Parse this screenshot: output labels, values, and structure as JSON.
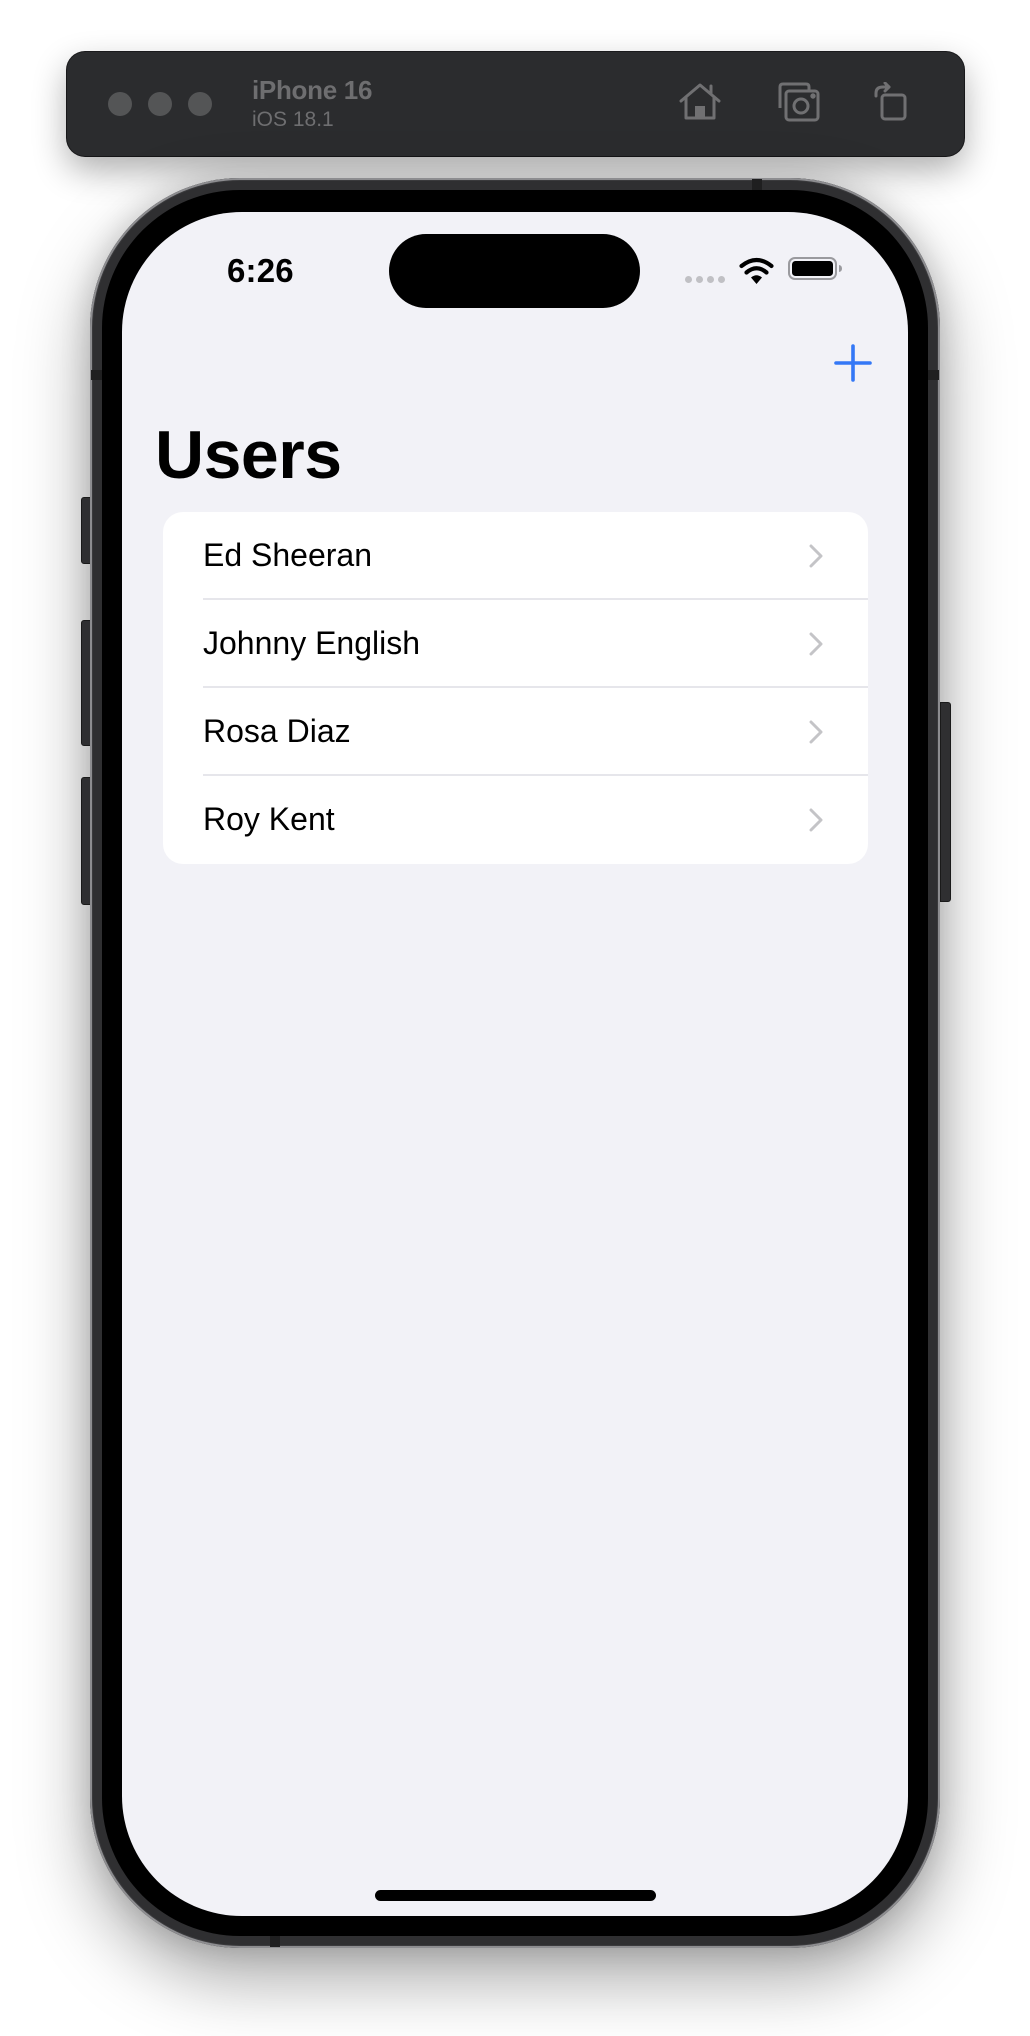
{
  "simulator": {
    "device_name": "iPhone 16",
    "os_version": "iOS 18.1",
    "toolbar_icons": [
      "home-icon",
      "screenshot-icon",
      "rotate-icon"
    ]
  },
  "status_bar": {
    "time": "6:26",
    "icons": [
      "cellular-signal-icon",
      "wifi-icon",
      "battery-icon"
    ]
  },
  "nav": {
    "title": "Users",
    "add_button_icon": "plus-icon",
    "accent_color": "#3478f6"
  },
  "users": {
    "items": [
      {
        "name": "Ed Sheeran"
      },
      {
        "name": "Johnny English"
      },
      {
        "name": "Rosa Diaz"
      },
      {
        "name": "Roy Kent"
      }
    ]
  },
  "colors": {
    "screen_background": "#f2f2f7",
    "card_background": "#ffffff",
    "chevron": "#c4c4c7",
    "toolbar_background": "#2b2c2e"
  }
}
